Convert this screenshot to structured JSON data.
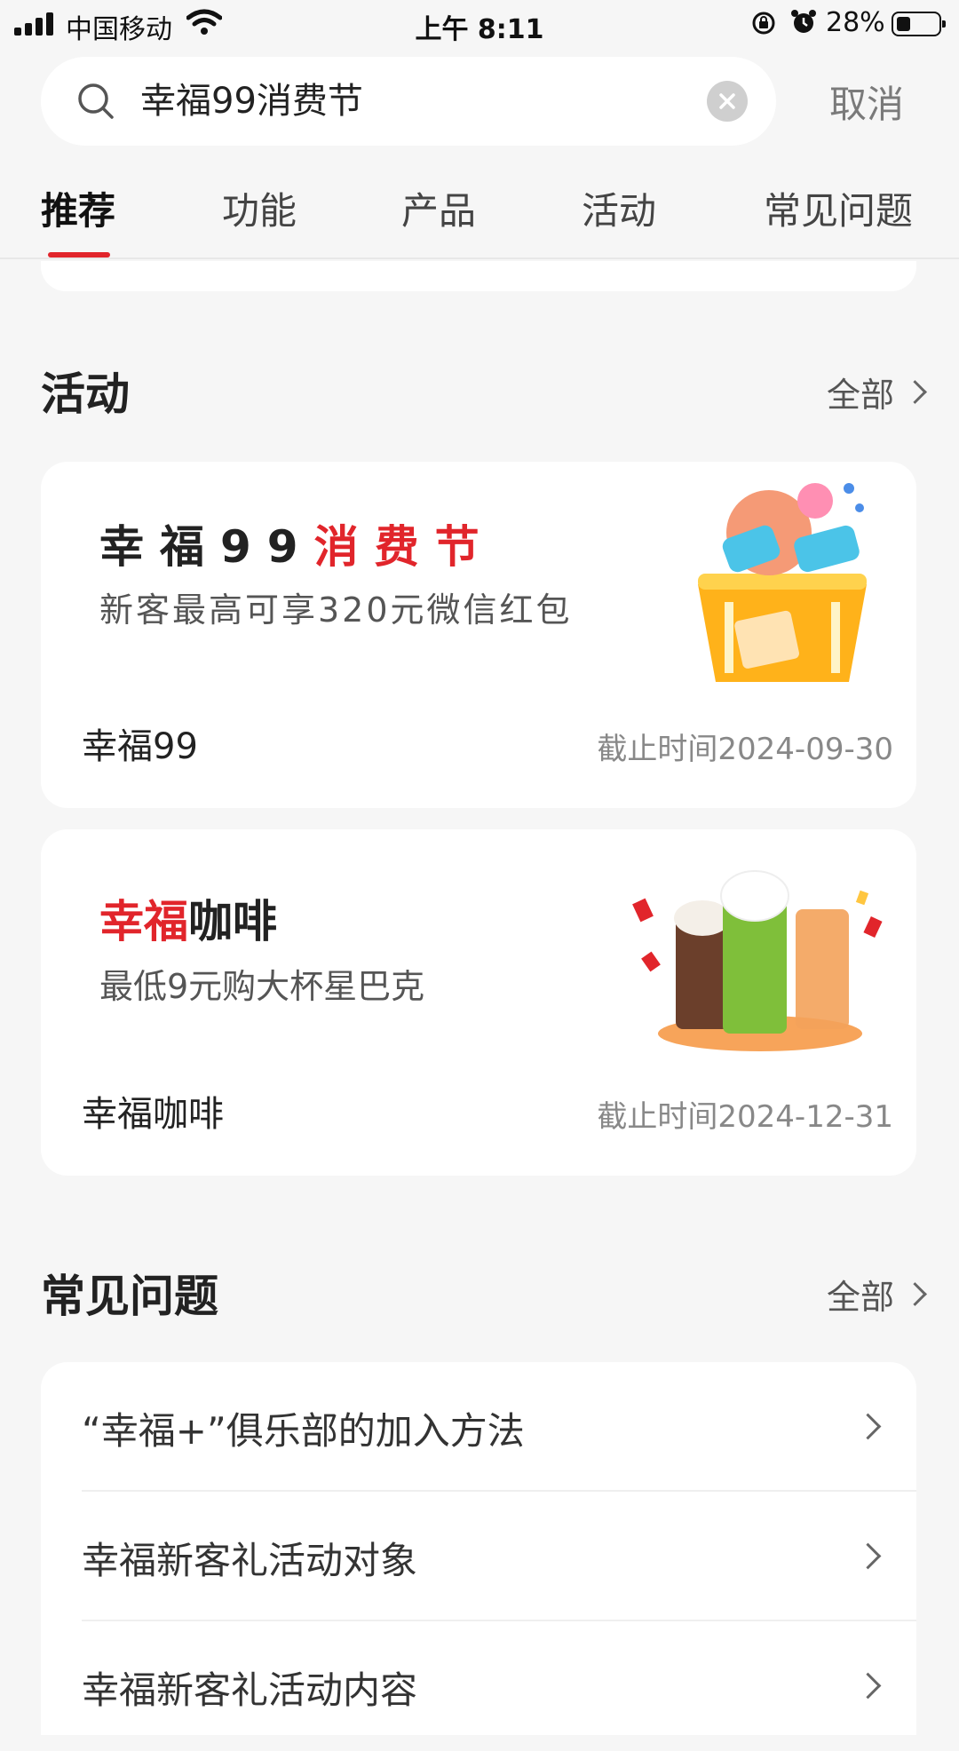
{
  "status_bar": {
    "carrier": "中国移动",
    "time": "上午 8:11",
    "battery_pct": "28%",
    "battery_level": 0.28
  },
  "search": {
    "query": "幸福99消费节",
    "cancel_label": "取消"
  },
  "tabs": [
    {
      "label": "推荐",
      "active": true
    },
    {
      "label": "功能",
      "active": false
    },
    {
      "label": "产品",
      "active": false
    },
    {
      "label": "活动",
      "active": false
    },
    {
      "label": "常见问题",
      "active": false
    }
  ],
  "activities": {
    "title": "活动",
    "more_label": "全部",
    "items": [
      {
        "headline_black": "幸福99",
        "headline_red": "消费节",
        "subtitle": "新客最高可享320元微信红包",
        "name": "幸福99",
        "deadline": "截止时间2024-09-30",
        "image_icon": "shopping-basket-gifts-illustration"
      },
      {
        "headline_red": "幸福",
        "headline_black": "咖啡",
        "subtitle": "最低9元购大杯星巴克",
        "name": "幸福咖啡",
        "deadline": "截止时间2024-12-31",
        "image_icon": "coffee-drinks-illustration"
      }
    ]
  },
  "faq": {
    "title": "常见问题",
    "more_label": "全部",
    "items": [
      {
        "question": "“幸福+”俱乐部的加入方法"
      },
      {
        "question": "幸福新客礼活动对象"
      },
      {
        "question": "幸福新客礼活动内容"
      }
    ]
  },
  "colors": {
    "accent_red": "#e1252b",
    "background": "#f6f6f6"
  }
}
